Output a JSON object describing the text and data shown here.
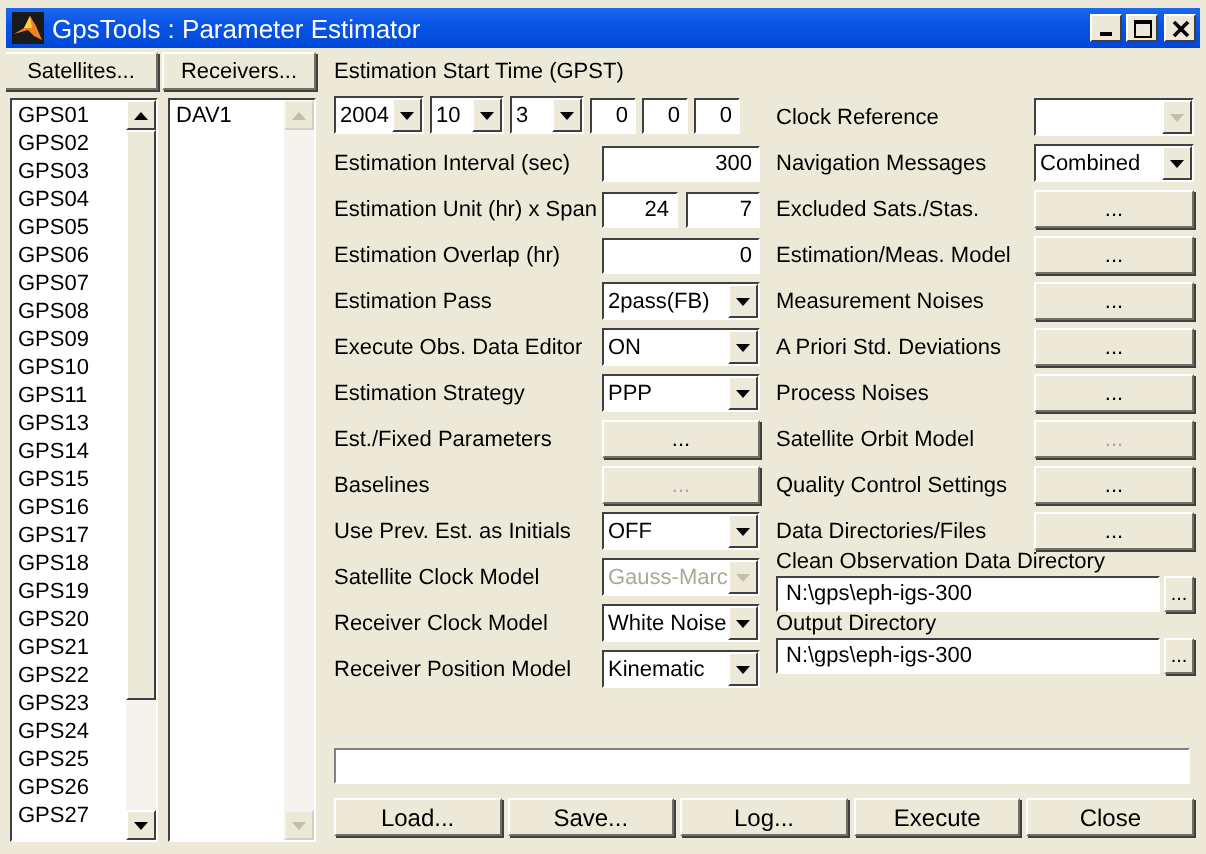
{
  "window": {
    "title": "GpsTools : Parameter Estimator"
  },
  "satellites": {
    "button": "Satellites...",
    "scrollable": true,
    "items": [
      "GPS01",
      "GPS02",
      "GPS03",
      "GPS04",
      "GPS05",
      "GPS06",
      "GPS07",
      "GPS08",
      "GPS09",
      "GPS10",
      "GPS11",
      "GPS13",
      "GPS14",
      "GPS15",
      "GPS16",
      "GPS17",
      "GPS18",
      "GPS19",
      "GPS20",
      "GPS21",
      "GPS22",
      "GPS23",
      "GPS24",
      "GPS25",
      "GPS26",
      "GPS27"
    ]
  },
  "receivers": {
    "button": "Receivers...",
    "scrollable": false,
    "items": [
      "DAV1"
    ]
  },
  "settings": [
    {
      "kind": "heading",
      "label": "Estimation Start Time (GPST)"
    },
    {
      "kind": "time",
      "selects": [
        "2004",
        "10",
        "3"
      ],
      "fields": [
        "0",
        "0",
        "0"
      ]
    },
    {
      "kind": "field",
      "label": "Estimation Interval (sec)",
      "value": "300"
    },
    {
      "kind": "pair",
      "label": "Estimation Unit (hr) x Span",
      "values": [
        "24",
        "7"
      ]
    },
    {
      "kind": "field",
      "label": "Estimation Overlap (hr)",
      "value": "0"
    },
    {
      "kind": "select",
      "label": "Estimation Pass",
      "value": "2pass(FB)",
      "disabled": false
    },
    {
      "kind": "select",
      "label": "Execute Obs. Data Editor",
      "value": "ON",
      "disabled": false
    },
    {
      "kind": "select",
      "label": "Estimation Strategy",
      "value": "PPP",
      "disabled": false
    },
    {
      "kind": "button",
      "label": "Est./Fixed Parameters",
      "button": "...",
      "disabled": false
    },
    {
      "kind": "button",
      "label": "Baselines",
      "button": "...",
      "disabled": true
    },
    {
      "kind": "select",
      "label": "Use Prev. Est. as Initials",
      "value": "OFF",
      "disabled": false
    },
    {
      "kind": "select",
      "label": "Satellite Clock Model",
      "value": "Gauss-Marc",
      "disabled": true
    },
    {
      "kind": "select",
      "label": "Receiver Clock Model",
      "value": "White Noise",
      "disabled": false
    },
    {
      "kind": "select",
      "label": "Receiver Position Model",
      "value": "Kinematic",
      "disabled": false
    }
  ],
  "options": [
    {
      "kind": "select",
      "label": "Clock Reference",
      "disabled": true
    },
    {
      "kind": "select",
      "label": "Navigation Messages",
      "value": "Combined",
      "disabled": false
    },
    {
      "kind": "button",
      "label": "Excluded Sats./Stas.",
      "button": "...",
      "disabled": false
    },
    {
      "kind": "button",
      "label": "Estimation/Meas. Model",
      "button": "...",
      "disabled": false
    },
    {
      "kind": "button",
      "label": "Measurement Noises",
      "button": "...",
      "disabled": false
    },
    {
      "kind": "button",
      "label": "A Priori Std. Deviations",
      "button": "...",
      "disabled": false
    },
    {
      "kind": "button",
      "label": "Process Noises",
      "button": "...",
      "disabled": false
    },
    {
      "kind": "button",
      "label": "Satellite Orbit Model",
      "button": "...",
      "disabled": true
    },
    {
      "kind": "button",
      "label": "Quality Control Settings",
      "button": "...",
      "disabled": false
    },
    {
      "kind": "button",
      "label": "Data Directories/Files",
      "button": "...",
      "disabled": false
    },
    {
      "kind": "path",
      "label": "Clean Observation Data Directory",
      "value": "N:\\gps\\eph-igs-300",
      "button": "..."
    },
    {
      "kind": "path",
      "label": "Output Directory",
      "value": "N:\\gps\\eph-igs-300",
      "button": "..."
    }
  ],
  "buttons": [
    "Load...",
    "Save...",
    "Log...",
    "Execute",
    "Close"
  ]
}
